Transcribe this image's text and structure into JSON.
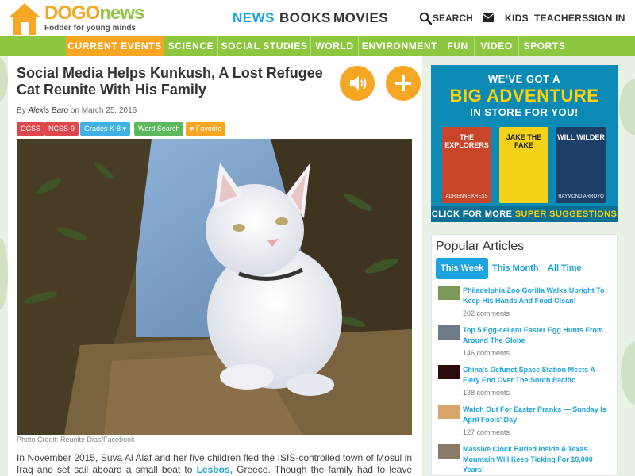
{
  "brand": {
    "logo_part1": "DOGO",
    "logo_part2": "news",
    "tagline": "Fodder for young minds",
    "orange": "#f5a623",
    "green": "#8dc63f",
    "blue": "#1aa3e0"
  },
  "main_nav": {
    "news": "NEWS",
    "books": "BOOKS",
    "movies": "MOVIES"
  },
  "utility_nav": {
    "search": "SEARCH",
    "mail_icon": "envelope-icon",
    "kids": "KIDS",
    "teachers": "TEACHERS",
    "sign_in": "SIGN IN"
  },
  "categories": [
    "CURRENT EVENTS",
    "SCIENCE",
    "SOCIAL STUDIES",
    "WORLD",
    "ENVIRONMENT",
    "FUN",
    "VIDEO",
    "SPORTS"
  ],
  "article": {
    "title": "Social Media Helps Kunkush, A Lost Refugee Cat Reunite With His Family",
    "by_prefix": "By",
    "author": "Alexis Baro",
    "date_text": "on March 25, 2016",
    "tags": [
      {
        "label": "CCSS",
        "color": "#e0474c"
      },
      {
        "label": "NCSS-9",
        "color": "#e0474c"
      },
      {
        "label": "Grades K-8 ▾",
        "color": "#3fb1e6"
      },
      {
        "label": "Word Search",
        "color": "#5bb85d"
      },
      {
        "label": "♥ Favorite",
        "color": "#f5a623"
      }
    ],
    "audio_icon": "speaker-icon",
    "add_icon": "plus-icon",
    "photo_credit": "Photo Credit: Reunite Dias/Facebook",
    "para_part1": "In November 2015, Suva Al Alaf and her five children fled the ISIS-controlled town of Mosul in Iraq and set sail aboard a small boat to",
    "para_link": "Lesbos,",
    "para_part2": "Greece. Though the family had to leave behind"
  },
  "ad": {
    "line1": "WE'VE GOT A",
    "line2": "BIG ADVENTURE",
    "line3": "IN STORE FOR YOU!",
    "books": [
      {
        "title": "THE EXPLORERS",
        "author": "ADRIENNE KRESS"
      },
      {
        "title": "JAKE THE FAKE",
        "author": ""
      },
      {
        "title": "WILL WILDER",
        "author": "RAYMOND ARROYO"
      }
    ],
    "footer_part1": "CLICK FOR MORE",
    "footer_part2": "SUPER SUGGESTIONS"
  },
  "popular": {
    "heading": "Popular Articles",
    "tabs": [
      "This Week",
      "This Month",
      "All Time"
    ],
    "items": [
      {
        "title": "Philadelphia Zoo Gorilla Walks Upright To Keep His Hands And Food Clean!",
        "comments": "202 comments"
      },
      {
        "title": "Top 5 Egg-cellent Easter Egg Hunts From Around The Globe",
        "comments": "146 comments"
      },
      {
        "title": "China's Defunct Space Station Meets A Fiery End Over The South Pacific",
        "comments": "138 comments"
      },
      {
        "title": "Watch Out For Easter Pranks — Sunday Is April Fools' Day",
        "comments": "127 comments"
      },
      {
        "title": "Massive Clock Buried Inside A Texas Mountain Will Keep Ticking For 10,000 Years!",
        "comments": ""
      }
    ]
  }
}
